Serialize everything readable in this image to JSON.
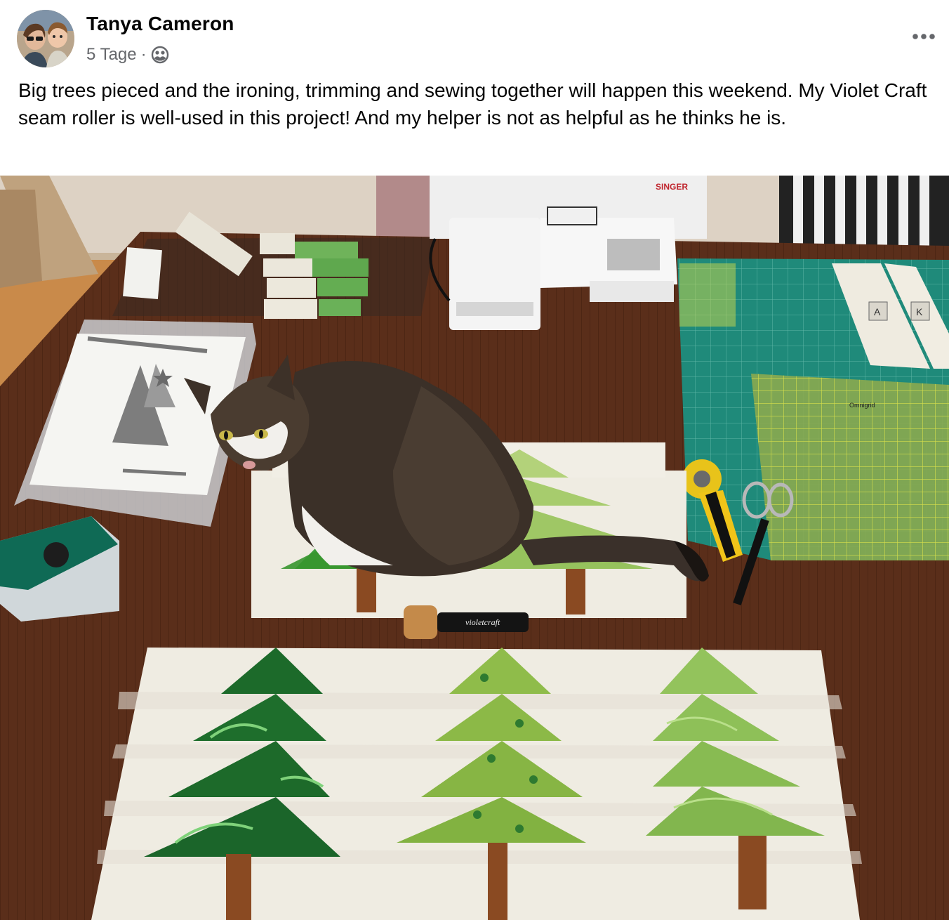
{
  "post": {
    "author": "Tanya Cameron",
    "time": "5 Tage",
    "separator": "·",
    "audience_icon": "friends-icon",
    "more_icon": "more-horizontal-icon",
    "text": "Big trees pieced and the ironing, trimming and sewing together will happen this weekend. My Violet Craft seam roller is well-used in this project! And my helper is not as helpful as he thinks he is."
  },
  "photo": {
    "machine_brand": "SINGER",
    "roller_brand": "violetcraft",
    "ruler_brand": "Omnigrid",
    "block_labels": [
      "A",
      "K"
    ]
  },
  "colors": {
    "text_primary": "#050505",
    "text_secondary": "#65676b",
    "table": "#5a2e1a",
    "cutting_mat": "#1f8a7a"
  }
}
